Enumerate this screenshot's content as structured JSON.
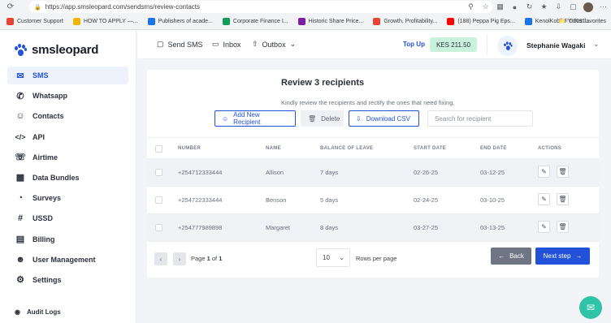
{
  "browser": {
    "url": "https://app.smsleopard.com/sendsms/review-contacts",
    "bookmarks": [
      {
        "label": "Customer Support",
        "color": "#e94335"
      },
      {
        "label": "HOW TO APPLY —...",
        "color": "#f4b400"
      },
      {
        "label": "Publishers of acade...",
        "color": "#1a73e8"
      },
      {
        "label": "Corporate Finance I...",
        "color": "#0f9d58"
      },
      {
        "label": "Historic Share Price...",
        "color": "#7b1fa2"
      },
      {
        "label": "Growth, Profitability...",
        "color": "#e94335"
      },
      {
        "label": "(188) Peppa Pig Eps...",
        "color": "#ff0000"
      },
      {
        "label": "KenolKobil-FY-2011...",
        "color": "#1a73e8"
      }
    ],
    "other_bookmarks": "Other favorites"
  },
  "brand": {
    "name": "smsleopard",
    "accent": "#2152d9"
  },
  "sidebar": {
    "items": [
      {
        "label": "SMS",
        "icon": "mail-icon"
      },
      {
        "label": "Whatsapp",
        "icon": "whatsapp-icon"
      },
      {
        "label": "Contacts",
        "icon": "contacts-icon"
      },
      {
        "label": "API",
        "icon": "code-icon"
      },
      {
        "label": "Airtime",
        "icon": "phone-icon"
      },
      {
        "label": "Data Bundles",
        "icon": "bar-chart-icon"
      },
      {
        "label": "Surveys",
        "icon": "pie-chart-icon"
      },
      {
        "label": "USSD",
        "icon": "hash-icon"
      },
      {
        "label": "Billing",
        "icon": "credit-card-icon"
      },
      {
        "label": "User Management",
        "icon": "user-management-icon"
      },
      {
        "label": "Settings",
        "icon": "gear-icon"
      }
    ],
    "audit_logs": "Audit Logs"
  },
  "topbar": {
    "send_sms": "Send SMS",
    "inbox": "Inbox",
    "outbox": "Outbox",
    "top_up": "Top Up",
    "balance": "KES 211.50",
    "user_name": "Stephanie Wagaki"
  },
  "review": {
    "title": "Review 3 recipients",
    "subtitle": "Kindly review the recipients and rectify the ones that need fixing.",
    "add_button": "Add New Recipient",
    "delete_button": "Delete",
    "download_button": "Download CSV",
    "search_placeholder": "Search for recipient"
  },
  "table": {
    "columns": [
      "NUMBER",
      "NAME",
      "BALANCE OF LEAVE",
      "START DATE",
      "END DATE",
      "ACTIONS"
    ],
    "rows": [
      {
        "number": "+254712333444",
        "name": "Allison",
        "balance": "7 days",
        "start": "02-26-25",
        "end": "03-12-25"
      },
      {
        "number": "+254722333444",
        "name": "Benson",
        "balance": "5 days",
        "start": "02-24-25",
        "end": "03-10-25"
      },
      {
        "number": "+254777989898",
        "name": "Margaret",
        "balance": "8 days",
        "start": "03-27-25",
        "end": "03-13-25"
      }
    ]
  },
  "pagination": {
    "page_word": "Page",
    "current": "1",
    "of_word": "of",
    "total": "1",
    "rows_per_page": "10",
    "rows_label": "Rows per page",
    "back": "Back",
    "next": "Next step"
  }
}
